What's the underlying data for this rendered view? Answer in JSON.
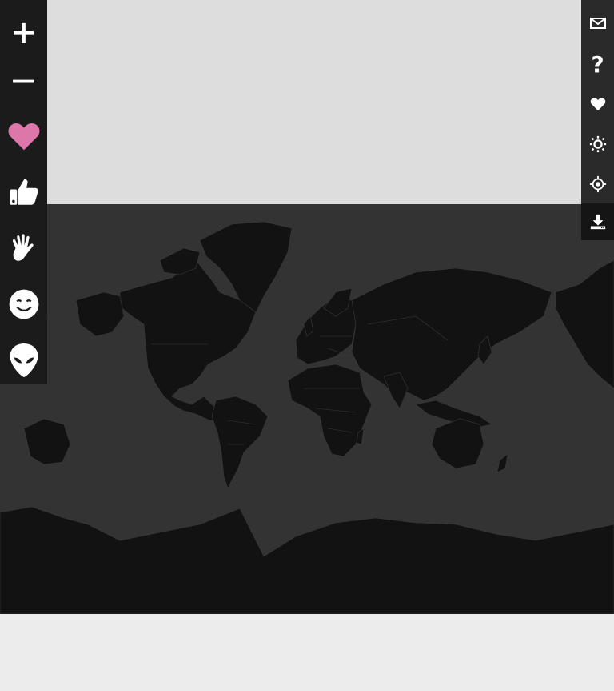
{
  "toolbar_left": {
    "zoom_in": "+",
    "zoom_out": "—",
    "reactions": [
      {
        "name": "heart",
        "color": "#dd77aa"
      },
      {
        "name": "thumbs-up",
        "color": "#ffffff"
      },
      {
        "name": "wave",
        "color": "#ffffff"
      },
      {
        "name": "smile",
        "color": "#ffffff"
      },
      {
        "name": "alien",
        "color": "#ffffff"
      }
    ]
  },
  "toolbar_right": {
    "items": [
      "mail-icon",
      "help-icon",
      "heart-icon",
      "brightness-icon",
      "locate-icon",
      "download-icon"
    ],
    "help_glyph": "?"
  },
  "colors": {
    "page_background": "#dddddd",
    "ocean": "#333333",
    "land": "#121212",
    "borders": "#3a3a3a",
    "toolbar": "#1b1b1b",
    "accent_heart": "#dd77aa"
  }
}
